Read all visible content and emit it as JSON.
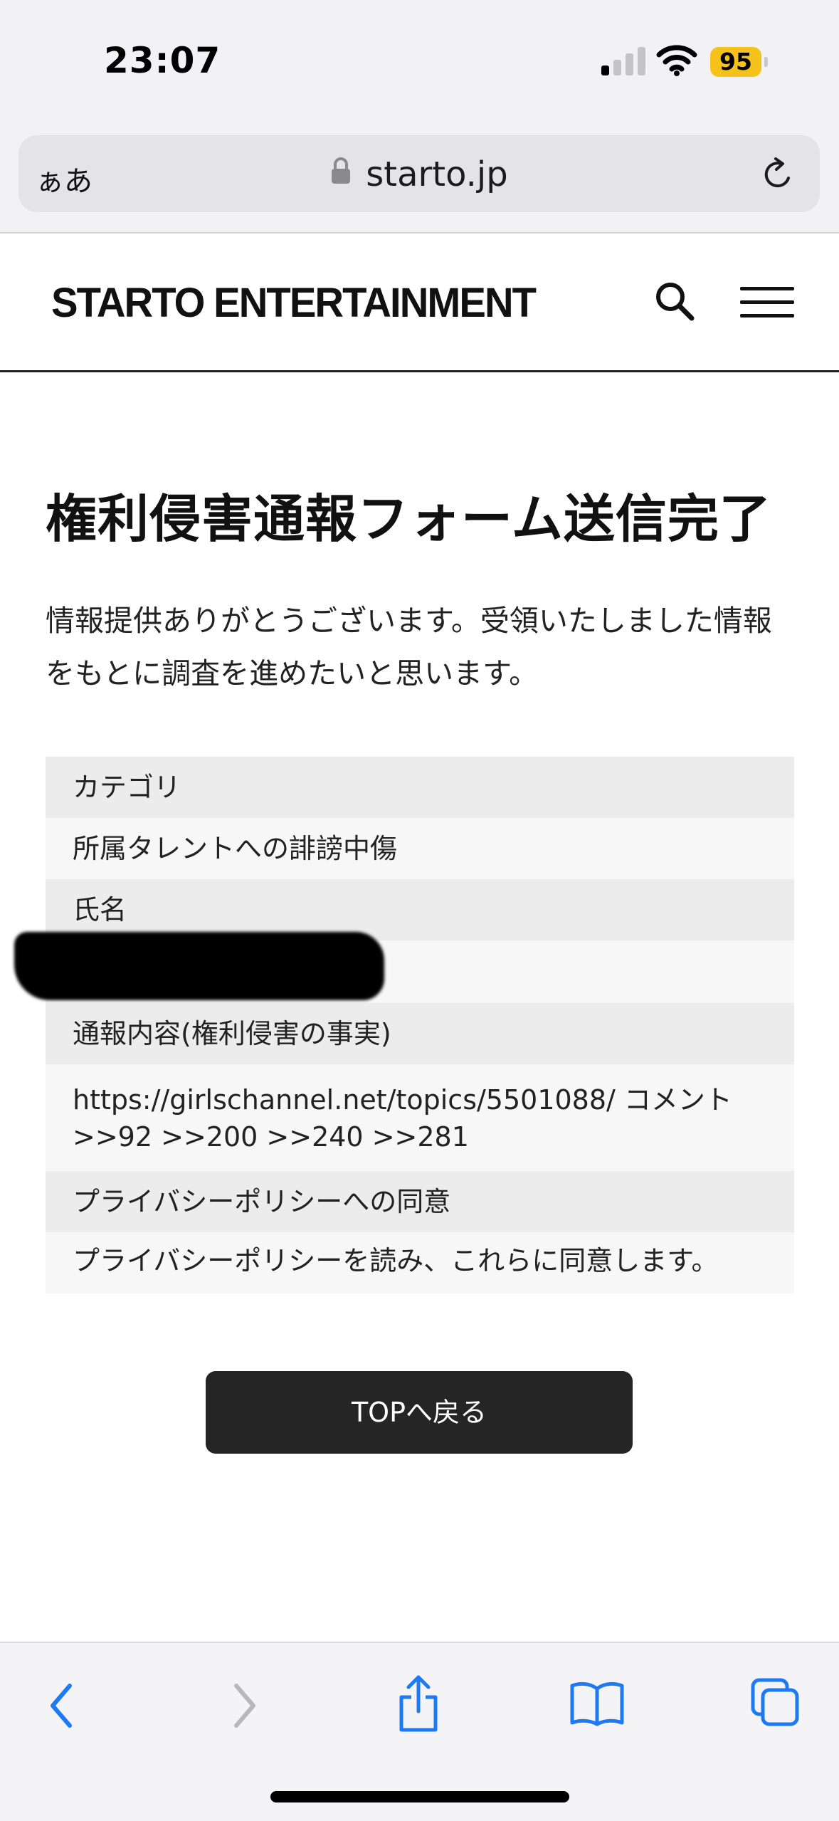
{
  "status_bar": {
    "time": "23:07",
    "battery_level": "95",
    "battery_color": "#f4c21a",
    "signal_bars_active": 1,
    "signal_bars_total": 4
  },
  "browser": {
    "text_size_label": "ぁあ",
    "url": "starto.jp",
    "accent_color": "#1d7af2"
  },
  "site": {
    "logo": "STARTO ENTERTAINMENT"
  },
  "content": {
    "title": "権利侵害通報フォーム送信完了",
    "intro": "情報提供ありがとうございます。受領いたしました情報をもとに調査を進めたいと思います。",
    "fields": [
      {
        "label": "カテゴリ",
        "value": "所属タレントへの誹謗中傷"
      },
      {
        "label": "氏名",
        "value": ""
      },
      {
        "label": "通報内容(権利侵害の事実)",
        "value": "https://girlschannel.net/topics/5501088/ コメント\n>>92 >>200 >>240 >>281"
      },
      {
        "label": "プライバシーポリシーへの同意",
        "value": "プライバシーポリシーを読み、これらに同意します。"
      }
    ],
    "back_button": "TOPへ戻る"
  }
}
